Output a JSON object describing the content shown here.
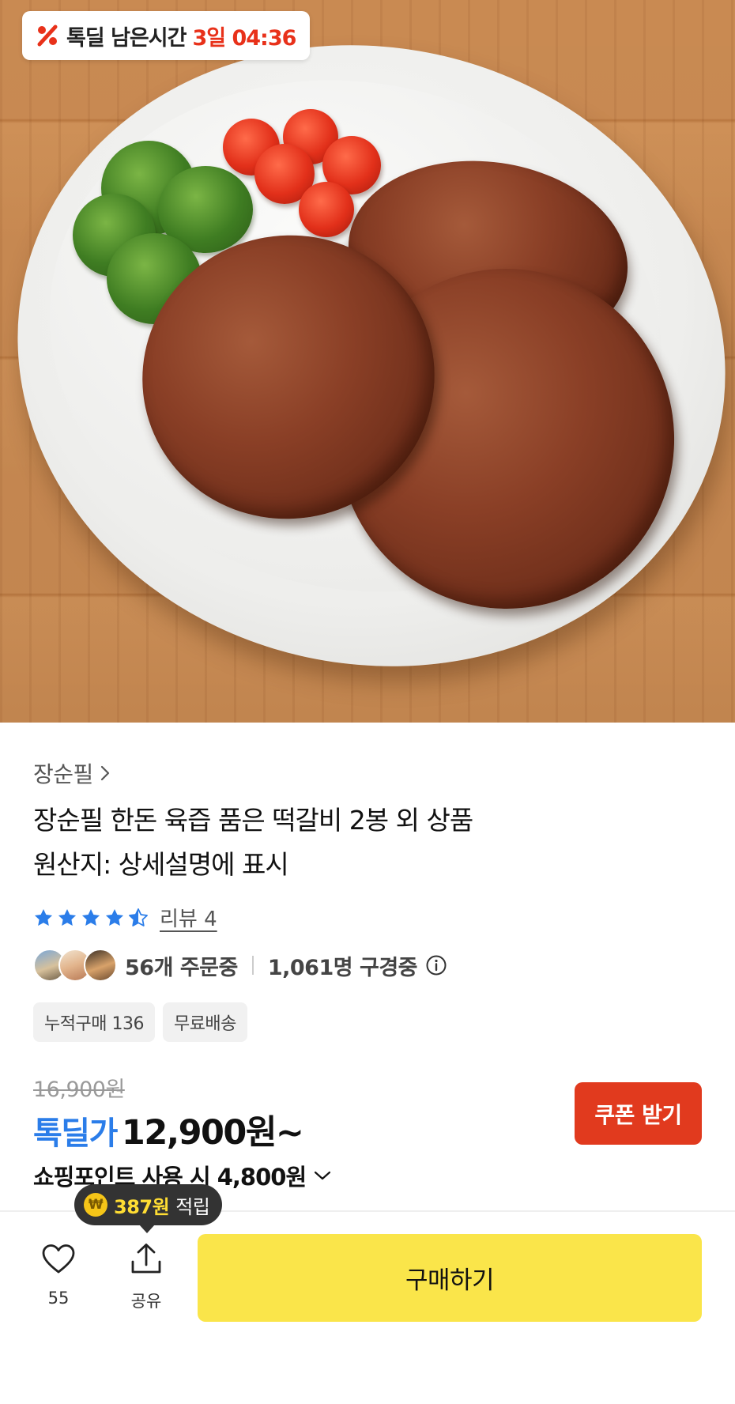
{
  "deal_timer": {
    "label": "톡딜 남은시간",
    "time": "3일 04:36",
    "icon": "percent-badge-icon",
    "accent_color": "#e8311a"
  },
  "product": {
    "image_alt": "plate-with-tteokgalbi-patties-tomatoes-broccoli",
    "brand": "장순필",
    "title_line1": "장순필 한돈 육즙 품은 떡갈비 2봉 외 상품",
    "title_line2": "원산지: 상세설명에 표시",
    "rating": 4.5,
    "review_label": "리뷰 4"
  },
  "social": {
    "ordering": "56개 주문중",
    "viewing": "1,061명 구경중"
  },
  "tags": [
    "누적구매 136",
    "무료배송"
  ],
  "price": {
    "original": "16,900원",
    "deal_label": "톡딜가",
    "deal_price": "12,900원~",
    "deal_color": "#2b7de9",
    "coupon_button": "쿠폰 받기",
    "coupon_color": "#e13a1e",
    "point_text": "쇼핑포인트 사용 시 4,800원"
  },
  "bottom_bar": {
    "reward_amount": "387원",
    "reward_suffix": "적립",
    "like_count": "55",
    "share_label": "공유",
    "buy_button": "구매하기",
    "buy_color": "#fae54a"
  }
}
